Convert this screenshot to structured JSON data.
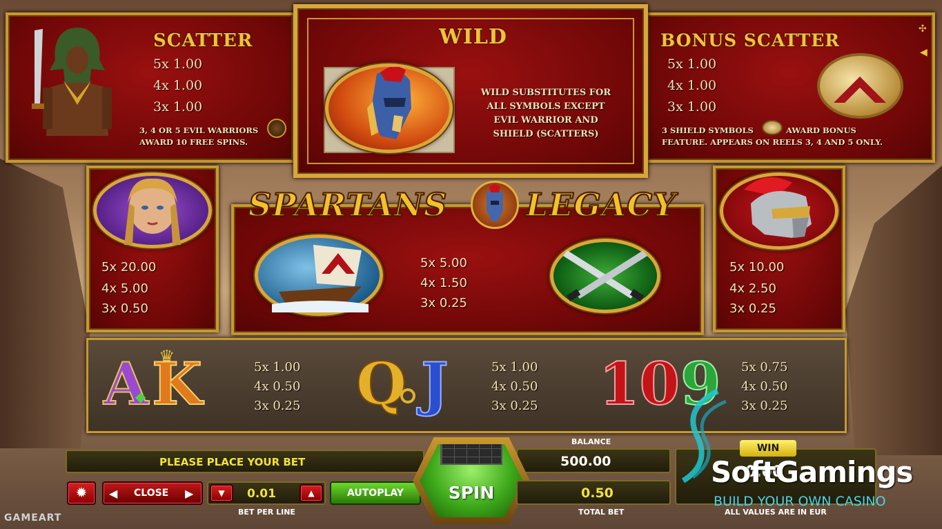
{
  "scatter": {
    "title": "SCATTER",
    "pays": [
      "5x 1.00",
      "4x 1.00",
      "3x 1.00"
    ],
    "note1": "3, 4 OR 5 EVIL WARRIORS",
    "note2": "AWARD 10 FREE SPINS."
  },
  "wild": {
    "title": "WILD",
    "desc": [
      "WILD SUBSTITUTES FOR",
      "ALL SYMBOLS EXCEPT",
      "EVIL WARRIOR AND",
      "SHIELD (SCATTERS)"
    ]
  },
  "bonus": {
    "title": "BONUS SCATTER",
    "pays": [
      "5x 1.00",
      "4x 1.00",
      "3x 1.00"
    ],
    "note1a": "3 SHIELD SYMBOLS",
    "note1b": "AWARD BONUS",
    "note2": "FEATURE. APPEARS ON REELS 3, 4 AND 5 ONLY."
  },
  "logo": {
    "part1": "SPARTANS",
    "part2": "LEGACY"
  },
  "woman": {
    "pays": [
      "5x 20.00",
      "4x 5.00",
      "3x 0.50"
    ]
  },
  "ship_swords": {
    "pays": [
      "5x 5.00",
      "4x 1.50",
      "3x 0.25"
    ]
  },
  "helmet": {
    "pays": [
      "5x 10.00",
      "4x 2.50",
      "3x 0.25"
    ]
  },
  "ak": {
    "letters": [
      "A",
      "K"
    ],
    "pays": [
      "5x 1.00",
      "4x 0.50",
      "3x 0.25"
    ]
  },
  "qj": {
    "letters": [
      "Q",
      "J"
    ],
    "pays": [
      "5x 1.00",
      "4x 0.50",
      "3x 0.25"
    ]
  },
  "ten_nine": {
    "letters": [
      "10",
      "9"
    ],
    "pays": [
      "5x 0.75",
      "4x 0.50",
      "3x 0.25"
    ]
  },
  "controls": {
    "message": "PLEASE PLACE YOUR BET",
    "balance_label": "BALANCE",
    "balance": "500.00",
    "close": "CLOSE",
    "bet_per_line": "0.01",
    "bet_per_line_label": "BET PER LINE",
    "autoplay": "AUTOPLAY",
    "spin": "SPIN",
    "total_bet": "0.50",
    "total_bet_label": "TOTAL BET",
    "win_label": "WIN",
    "win": "0.00",
    "currency_note": "ALL VALUES ARE IN EUR"
  },
  "provider": "GAMEART",
  "watermark": {
    "name": "SoftGamings",
    "tagline": "BUILD YOUR OWN CASINO"
  }
}
